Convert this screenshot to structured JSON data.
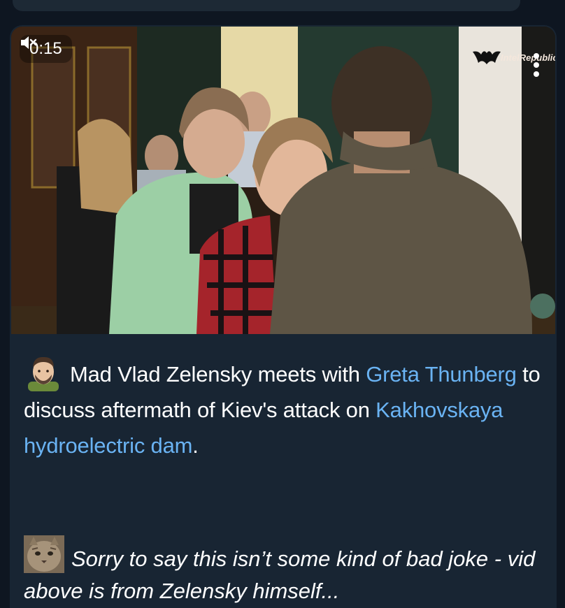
{
  "video": {
    "time": "0:15",
    "mute_icon": "speaker-muted-icon",
    "channel": "IntelRepublic",
    "more_icon": "vertical-dots-icon"
  },
  "post": {
    "emoji": "man-face-emoji",
    "text_1": "Mad Vlad Zelensky meets with ",
    "link_1": "Greta Thunberg",
    "text_2": " to discuss aftermath of Kiev's attack on ",
    "link_2": "Kakhovskaya hydroelectric dam",
    "text_3": ".",
    "quote_icon": "cat-face-thumbnail",
    "quote": "Sorry to say this isn’t some kind of bad joke - vid above is from Zelensky himself..."
  },
  "colors": {
    "background": "#0e1621",
    "bubble": "#182533",
    "link": "#6ab3f3",
    "text": "#ffffff"
  }
}
